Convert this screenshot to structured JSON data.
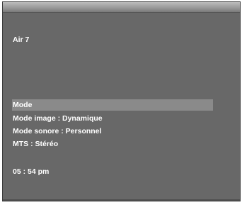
{
  "osd": {
    "channel": "Air  7",
    "menu": {
      "mode_label": "Mode",
      "picture_mode": "Mode image : Dynamique",
      "sound_mode": "Mode sonore : Personnel",
      "mts": "MTS : Stéréo"
    },
    "time": "05 : 54 pm"
  },
  "colors": {
    "background": "#686868",
    "highlight": "#8a8a8a",
    "text": "#ffffff"
  }
}
